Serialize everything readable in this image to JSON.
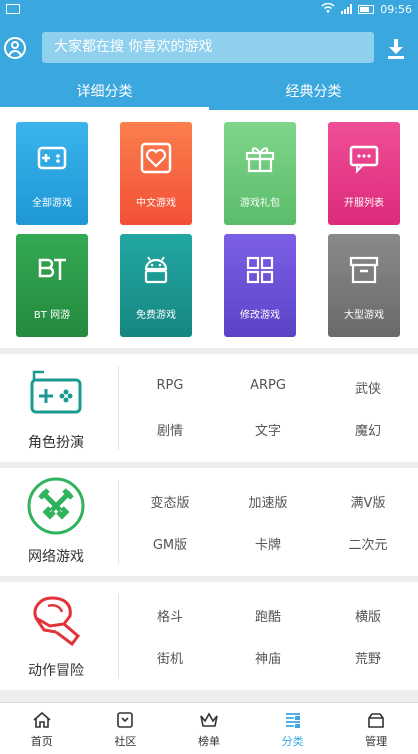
{
  "status_bar": {
    "time": "09:56"
  },
  "search": {
    "placeholder": "大家都在搜 你喜欢的游戏"
  },
  "tabs": [
    {
      "label": "详细分类",
      "active": true
    },
    {
      "label": "经典分类",
      "active": false
    }
  ],
  "tiles": [
    {
      "label": "全部游戏",
      "icon": "gamepad-icon",
      "color": "#2ca7e0"
    },
    {
      "label": "中文游戏",
      "icon": "heart-icon",
      "color": "#f6663f"
    },
    {
      "label": "游戏礼包",
      "icon": "gift-icon",
      "color": "#6cc777"
    },
    {
      "label": "开服列表",
      "icon": "chat-icon",
      "color": "#e83a8a"
    },
    {
      "label": "BT 网游",
      "icon": "bt-icon",
      "color": "#2f9e49"
    },
    {
      "label": "免费游戏",
      "icon": "android-icon",
      "color": "#1d9a96"
    },
    {
      "label": "修改游戏",
      "icon": "grid-icon",
      "color": "#6a55d6"
    },
    {
      "label": "大型游戏",
      "icon": "box-icon",
      "color": "#7c7c7c"
    }
  ],
  "sections": [
    {
      "title": "角色扮演",
      "icon": "controller-icon",
      "items": [
        "RPG",
        "ARPG",
        "武侠",
        "剧情",
        "文字",
        "魔幻"
      ]
    },
    {
      "title": "网络游戏",
      "icon": "crossed-swords-icon",
      "items": [
        "变态版",
        "加速版",
        "满V版",
        "GM版",
        "卡牌",
        "二次元"
      ]
    },
    {
      "title": "动作冒险",
      "icon": "boxing-glove-icon",
      "items": [
        "格斗",
        "跑酷",
        "横版",
        "街机",
        "神庙",
        "荒野"
      ]
    }
  ],
  "bottom_nav": [
    {
      "label": "首页",
      "icon": "home-icon",
      "active": false
    },
    {
      "label": "社区",
      "icon": "community-icon",
      "active": false
    },
    {
      "label": "榜单",
      "icon": "crown-icon",
      "active": false
    },
    {
      "label": "分类",
      "icon": "category-icon",
      "active": true
    },
    {
      "label": "管理",
      "icon": "manage-icon",
      "active": false
    }
  ],
  "colors": {
    "primary": "#3aa7df"
  }
}
